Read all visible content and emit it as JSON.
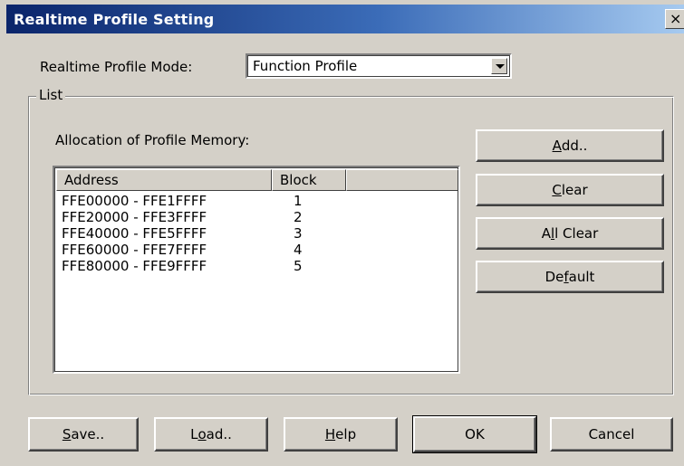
{
  "window": {
    "title": "Realtime Profile Setting",
    "close_glyph": "×"
  },
  "mode": {
    "label": "Realtime Profile Mode:",
    "selected": "Function Profile"
  },
  "list_group": {
    "legend": "List",
    "allocation_label": "Allocation of Profile Memory:"
  },
  "table": {
    "columns": [
      "Address",
      "Block"
    ],
    "rows": [
      {
        "address": "FFE00000 - FFE1FFFF",
        "block": "1"
      },
      {
        "address": "FFE20000 - FFE3FFFF",
        "block": "2"
      },
      {
        "address": "FFE40000 - FFE5FFFF",
        "block": "3"
      },
      {
        "address": "FFE60000 - FFE7FFFF",
        "block": "4"
      },
      {
        "address": "FFE80000 - FFE9FFFF",
        "block": "5"
      }
    ]
  },
  "side_buttons": {
    "add": {
      "pre": "",
      "mnemonic": "A",
      "post": "dd.."
    },
    "clear": {
      "pre": "",
      "mnemonic": "C",
      "post": "lear"
    },
    "all_clear": {
      "pre": "A",
      "mnemonic": "l",
      "post": "l Clear"
    },
    "default": {
      "pre": "De",
      "mnemonic": "f",
      "post": "ault"
    }
  },
  "bottom_buttons": {
    "save": {
      "pre": "",
      "mnemonic": "S",
      "post": "ave.."
    },
    "load": {
      "pre": "L",
      "mnemonic": "o",
      "post": "ad.."
    },
    "help": {
      "pre": "",
      "mnemonic": "H",
      "post": "elp"
    },
    "ok": "OK",
    "cancel": "Cancel"
  }
}
